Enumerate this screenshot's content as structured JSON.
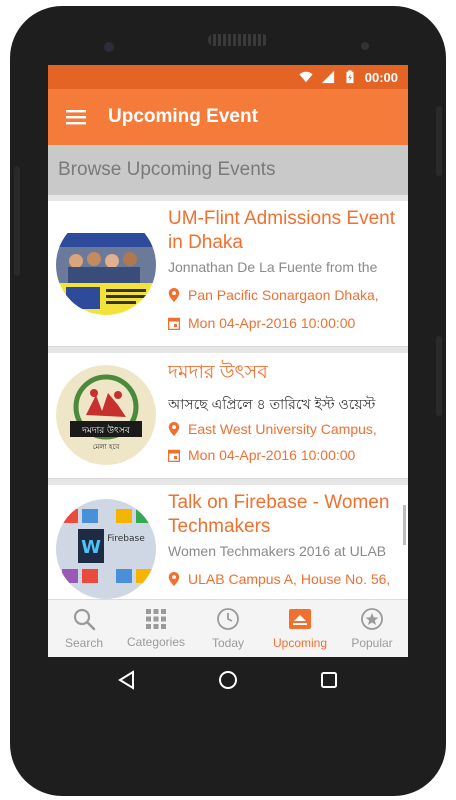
{
  "status": {
    "time": "00:00"
  },
  "appbar": {
    "title": "Upcoming Event"
  },
  "subheader": {
    "text": "Browse Upcoming Events"
  },
  "events": [
    {
      "title": "UM-Flint Admissions Event in Dhaka",
      "description": "Jonnathan De La Fuente from the",
      "location": "Pan Pacific Sonargaon Dhaka,",
      "datetime": "Mon 04-Apr-2016 10:00:00",
      "thumb_text": "DO YOU WANT TO STUDY"
    },
    {
      "title": "দমদার উৎসব",
      "description": "আসছে এপ্রিলে ৪ তারিখে ইস্ট ওয়েস্ট",
      "location": "East West University Campus,",
      "datetime": "Mon 04-Apr-2016 10:00:00",
      "thumb_text": "দমদার উৎসব",
      "thumb_sub": "মেলা হবে"
    },
    {
      "title": "Talk on Firebase - Women Techmakers",
      "description": "Women Techmakers 2016 at ULAB",
      "location": "ULAB Campus A, House No. 56,",
      "thumb_text": "Firebase"
    }
  ],
  "bottom_nav": [
    {
      "label": "Search",
      "icon": "search-icon"
    },
    {
      "label": "Categories",
      "icon": "grid-icon"
    },
    {
      "label": "Today",
      "icon": "clock-icon"
    },
    {
      "label": "Upcoming",
      "icon": "upcoming-icon",
      "active": true
    },
    {
      "label": "Popular",
      "icon": "star-icon"
    }
  ],
  "colors": {
    "accent": "#f47b3a",
    "statusbar": "#e46426",
    "text_accent": "#f07030"
  }
}
